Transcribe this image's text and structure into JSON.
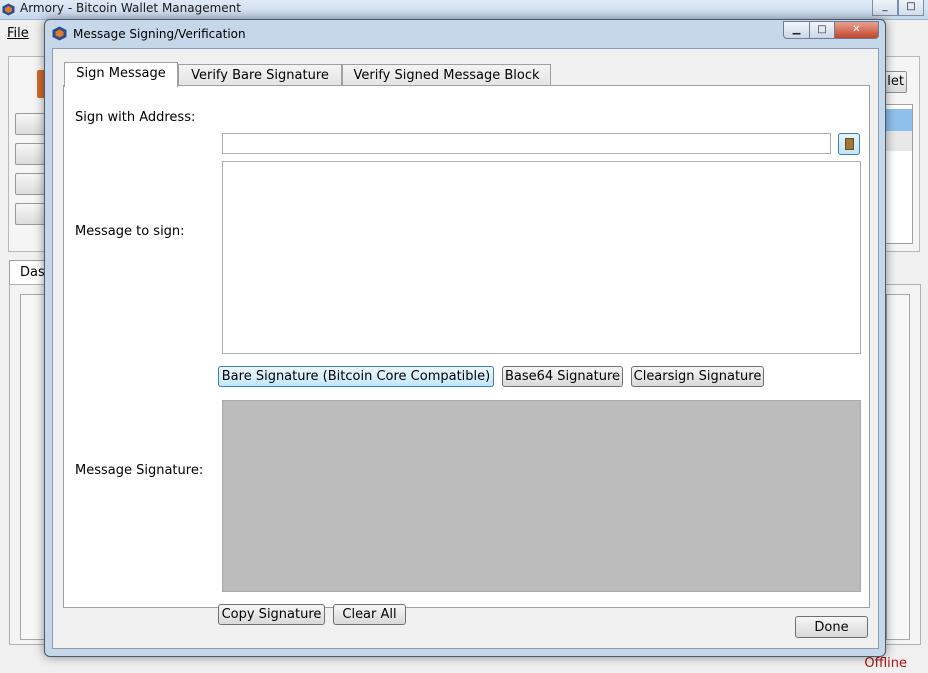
{
  "main_window": {
    "title": "Armory - Bitcoin Wallet Management",
    "menu_file": "File",
    "wallet_button_partial": "let",
    "tab_partial": "Das",
    "status": "Offline"
  },
  "dialog": {
    "title": "Message Signing/Verification",
    "tabs": [
      {
        "label": "Sign Message",
        "active": true
      },
      {
        "label": "Verify Bare Signature",
        "active": false
      },
      {
        "label": "Verify Signed Message Block",
        "active": false
      }
    ],
    "sign_address_label": "Sign with Address:",
    "sign_address_value": "",
    "message_label": "Message to sign:",
    "message_value": "",
    "signature_label": "Message Signature:",
    "signature_buttons": {
      "bare": "Bare Signature (Bitcoin Core Compatible)",
      "base64": "Base64 Signature",
      "clearsign": "Clearsign Signature"
    },
    "copy_button": "Copy Signature",
    "clear_button": "Clear All",
    "done_button": "Done"
  },
  "colors": {
    "signature_area": "#bcbcbc",
    "offline_status": "#b01010",
    "hover_accent": "#3c7fb1"
  },
  "icons": [
    "armory-logo-icon",
    "address-book-icon",
    "minimize-icon",
    "maximize-icon",
    "close-icon"
  ]
}
